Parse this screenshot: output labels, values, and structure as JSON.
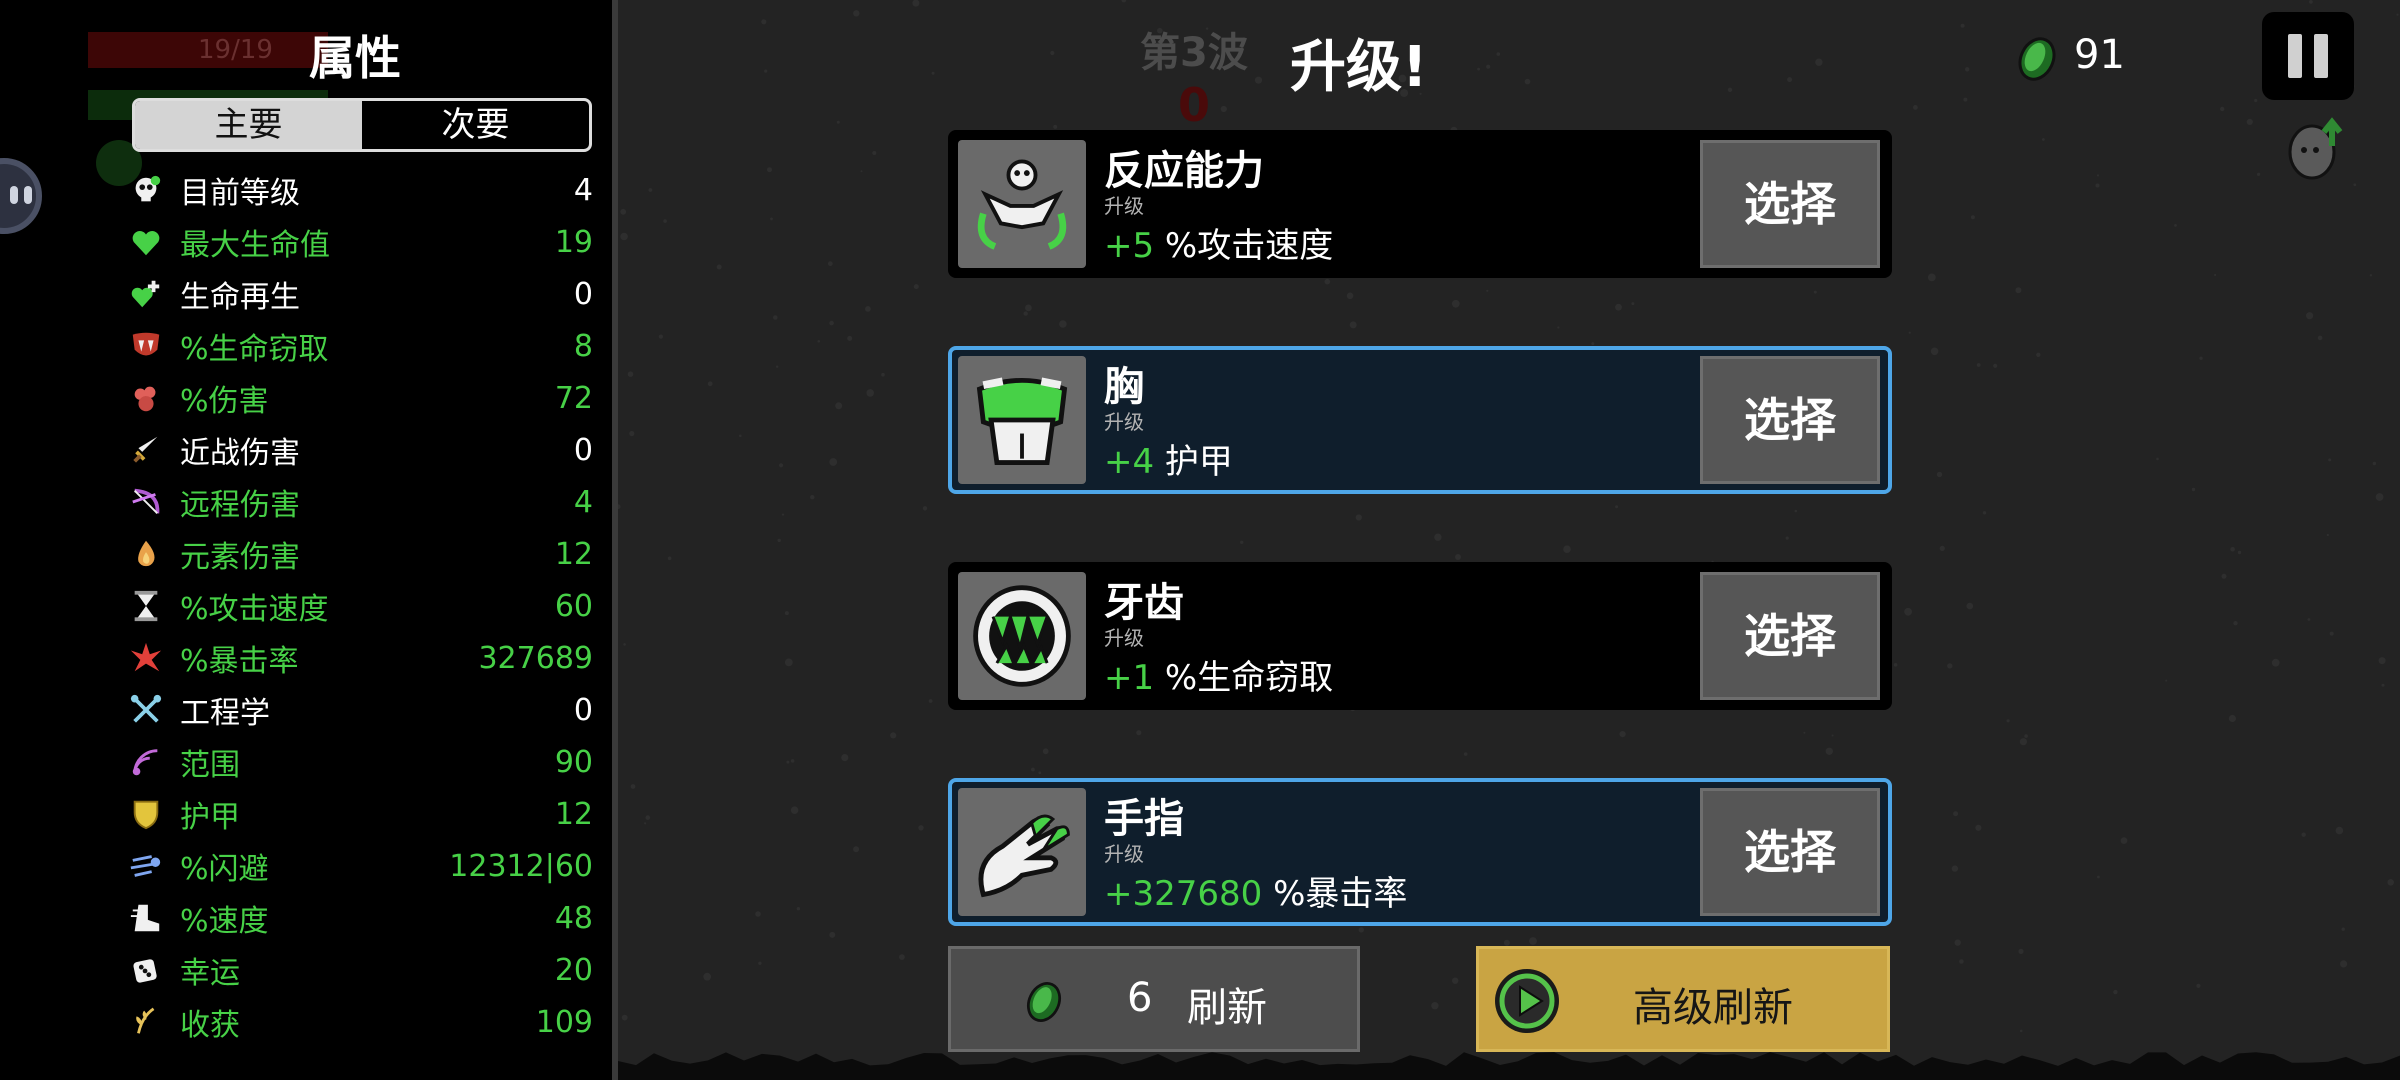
{
  "panel": {
    "title": "属性",
    "tabs": {
      "primary": "主要",
      "secondary": "次要"
    },
    "ghost_hp": "19/19"
  },
  "stats": [
    {
      "name": "目前等级",
      "value": "4",
      "name_color": "#ffffff",
      "value_color": "#ffffff",
      "icon": "skull-level-icon"
    },
    {
      "name": "最大生命值",
      "value": "19",
      "name_color": "#47d147",
      "value_color": "#47d147",
      "icon": "heart-icon"
    },
    {
      "name": "生命再生",
      "value": "0",
      "name_color": "#ffffff",
      "value_color": "#ffffff",
      "icon": "regen-heart-icon"
    },
    {
      "name": "%生命窃取",
      "value": "8",
      "name_color": "#47d147",
      "value_color": "#47d147",
      "icon": "fangs-icon"
    },
    {
      "name": "%伤害",
      "value": "72",
      "name_color": "#47d147",
      "value_color": "#47d147",
      "icon": "fist-icon"
    },
    {
      "name": "近战伤害",
      "value": "0",
      "name_color": "#ffffff",
      "value_color": "#ffffff",
      "icon": "sword-icon"
    },
    {
      "name": "远程伤害",
      "value": "4",
      "name_color": "#47d147",
      "value_color": "#47d147",
      "icon": "bow-icon"
    },
    {
      "name": "元素伤害",
      "value": "12",
      "name_color": "#47d147",
      "value_color": "#47d147",
      "icon": "flame-icon"
    },
    {
      "name": "%攻击速度",
      "value": "60",
      "name_color": "#47d147",
      "value_color": "#47d147",
      "icon": "hourglass-icon"
    },
    {
      "name": "%暴击率",
      "value": "327689",
      "name_color": "#47d147",
      "value_color": "#47d147",
      "icon": "crit-burst-icon"
    },
    {
      "name": "工程学",
      "value": "0",
      "name_color": "#ffffff",
      "value_color": "#ffffff",
      "icon": "wrench-icon"
    },
    {
      "name": "范围",
      "value": "90",
      "name_color": "#47d147",
      "value_color": "#47d147",
      "icon": "range-icon"
    },
    {
      "name": "护甲",
      "value": "12",
      "name_color": "#47d147",
      "value_color": "#47d147",
      "icon": "shield-icon"
    },
    {
      "name": "%闪避",
      "value": "12312|60",
      "name_color": "#47d147",
      "value_color": "#47d147",
      "icon": "dodge-icon"
    },
    {
      "name": "%速度",
      "value": "48",
      "name_color": "#47d147",
      "value_color": "#47d147",
      "icon": "boot-icon"
    },
    {
      "name": "幸运",
      "value": "20",
      "name_color": "#47d147",
      "value_color": "#47d147",
      "icon": "dice-icon"
    },
    {
      "name": "收获",
      "value": "109",
      "name_color": "#47d147",
      "value_color": "#47d147",
      "icon": "harvest-icon"
    }
  ],
  "header": {
    "wave": "第3波",
    "timer": "0",
    "title": "升级!",
    "materials": "91"
  },
  "upgrades": [
    {
      "name": "反应能力",
      "sub": "升级",
      "amount": "+5",
      "effect": " %攻击速度",
      "button": "选择",
      "icon": "reflexes-icon",
      "selected": false
    },
    {
      "name": "胸",
      "sub": "升级",
      "amount": "+4",
      "effect": " 护甲",
      "button": "选择",
      "icon": "chest-icon",
      "selected": true
    },
    {
      "name": "牙齿",
      "sub": "升级",
      "amount": "+1",
      "effect": " %生命窃取",
      "button": "选择",
      "icon": "teeth-icon",
      "selected": false
    },
    {
      "name": "手指",
      "sub": "升级",
      "amount": "+327680",
      "effect": " %暴击率",
      "button": "选择",
      "icon": "fingers-icon",
      "selected": true
    }
  ],
  "reroll": {
    "cost": "6",
    "label": "刷新"
  },
  "advanced_reroll": {
    "label": "高级刷新"
  },
  "colors": {
    "green": "#47d147",
    "select_border": "#4ea6e8",
    "gold": "#c9a443"
  }
}
